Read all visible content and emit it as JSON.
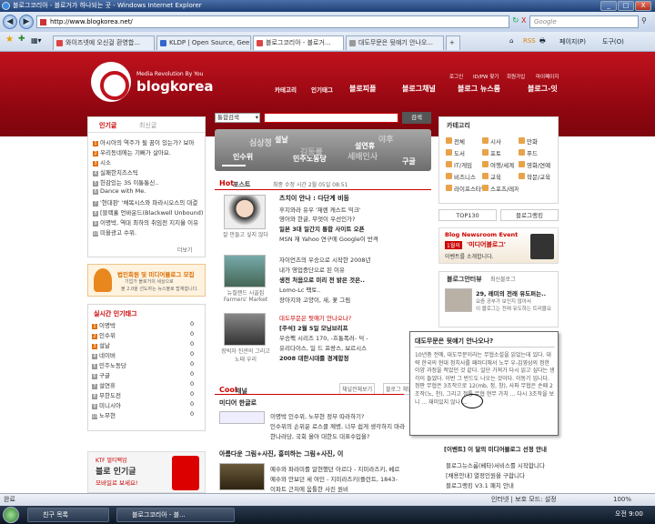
{
  "window": {
    "title": "블로그코리아 - 블로거가 하나되는 곳 - Windows Internet Explorer",
    "min": "_",
    "max": "□",
    "close": "X"
  },
  "address": {
    "url": "http://www.blogkorea.net/",
    "search_placeholder": "Google",
    "back": "◀",
    "forward": "▶",
    "refresh": "↻",
    "stop": "X"
  },
  "tabs": [
    "와이즈넷에 오신걸 환영합...",
    "KLDP | Open Source, Gee...",
    "블로그코리아 - 블로거...",
    "대도무문은 뒷얘기 안나오..."
  ],
  "toolbar": {
    "home": "⌂",
    "feeds": "RSS",
    "print": "🖶",
    "page": "페이지(P)",
    "tools": "도구(O)"
  },
  "site": {
    "logo": "blogkorea",
    "tagline": "Media Revolution By You",
    "toplinks": [
      "로그인",
      "ID/PW 찾기",
      "회원가입",
      "마이페이지"
    ],
    "nav": [
      "카테고리",
      "인기태그",
      "블로피플",
      "블로그채널",
      "블로그 뉴스룸",
      "블로그-잇"
    ],
    "search": {
      "scope": "통합검색",
      "button": "검색"
    },
    "popular": {
      "tab1": "인기글",
      "tab2": "최신글",
      "more": "더보기",
      "items": [
        "아시아의 역주가 될 꿈이 있는가? 보아",
        "우리동네에는 기뻐가 살아요.",
        "시소",
        "실패한치즈스틱",
        "헌감있는 3S 이통통신..",
        "Dance with Me.",
        "'현대판' '채목시스와 파라시오스의 대결",
        "[블랙홀 언바운드(Blackwell Unbound)]",
        "이명박, 역대 최하의 취임전 지지율 이유",
        "미을광고 수위."
      ]
    },
    "tagcloud": {
      "words": [
        "심상정",
        "설날",
        "야후",
        "김동률",
        "설연휴",
        "인수위",
        "민주노동당",
        "세배인사",
        "구글"
      ]
    },
    "hotpost": {
      "label": "Hot",
      "label2": "포스트",
      "updated": "최종 수정 시간 2월 05일 08:51",
      "main_title": "츠치이 안나 : 다단계 비등",
      "main_lines": [
        "후지와라 유우 '재렌 캐스트 믹크'",
        "영어와 한글, 무엇이 우선인가?"
      ],
      "main_bold1": "일본 3대 일간지 통합 사이트 오픈",
      "main_line2": "MSN 재 Yahoo 연구에 Google이 반격",
      "thumb1_caption": "잘 만들고 싶지 않다",
      "second_lines": [
        "자이언츠의 우승으로 시작한 2008년",
        "내가 영업중단으로 된 이유",
        "연말상을 받은 남자에게 무서운 거"
      ],
      "second_bold": "생전 처음으로 미리 전 밝은 것은..",
      "second_lines2": [
        "Lomo-Lc 팩토..",
        "장아지와 고양이, 새, 꽃 그림"
      ],
      "thumb2_caption": "뉴질랜드 시골집 Farmers' Market",
      "third_lines": [
        "대도무문은 뒷얘기 안나오나?",
        "[주석] 2월 5일 모닝브리프",
        "우승팩 시리즈 170, -흐통폭러- 덕 -"
      ],
      "third_bold": "2008 대한시대를 경계합정",
      "third_lines2": [
        "유리다이스, 일 드 프랑스, 보르시스"
      ],
      "thumb3_caption": "장빅자 진관의 그리고 노태 우리"
    },
    "cool": {
      "label": "Cool",
      "label2": "채널",
      "more1": "채널전체보기",
      "more2": "블로그 채널",
      "sub": "미디어 한글로",
      "lines": [
        "이명박 인수위, 노무현 정부 따라하기?",
        "인수위의 손위운 로스클 께병, 너무 쉽게 생각하지 마라",
        "한나라당, 국회 올아 대한도 대표수입을?"
      ],
      "sub2": "아름다운 그림+사진, 흥미하는 그림+사진, 이",
      "lines2": [
        "예수와 파라미를 알현했던 아르다 - 지미라즈키, 베르",
        "예수와 안보던 세 여인 - 지미라즈키(플런트, 1843-",
        "이파트 근처에 움툴한 사진 원비"
      ]
    },
    "tags": {
      "title": "실시간 인기태그",
      "items": [
        {
          "name": "이명박",
          "n": "0"
        },
        {
          "name": "인수위",
          "n": "0"
        },
        {
          "name": "설날",
          "n": "0"
        },
        {
          "name": "네이버",
          "n": "0"
        },
        {
          "name": "민주노동당",
          "n": "0"
        },
        {
          "name": "구글",
          "n": "0"
        },
        {
          "name": "설연휴",
          "n": "0"
        },
        {
          "name": "무한도전",
          "n": "0"
        },
        {
          "name": "미니시아",
          "n": "0"
        },
        {
          "name": "노무현",
          "n": "0"
        }
      ]
    },
    "promo": {
      "title": "법인회원 및 미디어블로그 모집",
      "sub": "기업가 블로거의 세상으로",
      "sub2": "블 2.0을 선도하는 뉴스블로 탑재합니다."
    },
    "ktf": {
      "line1": "KTF 멀티팩업",
      "line2": "블로 인기글",
      "line3": "모바일로 보세요!"
    },
    "category": {
      "title": "카테고리",
      "items": [
        "전체",
        "시사",
        "만화",
        "도서",
        "포토",
        "푸드",
        "IT/게임",
        "여행/세계",
        "영화/연예",
        "비즈니스",
        "교육",
        "학문/교육",
        "라이프스타일",
        "스포츠/레저"
      ]
    },
    "top130": "TOP130",
    "blogrank": "블로그랭킹",
    "event": {
      "line1": "Blog Newsroom Event",
      "line2": "1월의",
      "line3": "'미디어블로그'",
      "line4": "이벤트를 소개합니다."
    },
    "blogger": {
      "tab1": "블로그안터뷰",
      "tab2": "최신블로그",
      "title": "29, 레미의 전래 유도퍼는..",
      "lines": [
        "요즘 공부가 보인지 않아서",
        "이 블로그는 전래 유도하는 트러블요"
      ]
    },
    "popup": {
      "title": "대도무문은 뒷얘기 안나오나?",
      "text": "10년층 전에, 대도무문이라는 무협소설을 읽었는데 있다. 대략 한국의 현대 정치사를 패러디해서 노무 우-김영삼의 정한 이양 과정을 적었던 것 같다. 일단 가져가 다시 읽고 싶다는 생각이 들었다. 이번 그 반드도 나오는 것이다. 이동기 입니다. 정판 무협은 3조작으로 12(mb, 정, 창), 사파 무협은 손패 2조작(노, 천), 그리고 정통 무협 현무 가치 ... 다시 3조작을 보니 ... 재미있지 않나 ..."
    },
    "events2": {
      "title": "[이벤트] 이 달의 미디어블로그 선정 안내",
      "lines": [
        "블로그뉴스룸(베타)서비스를 시작합니다",
        "[채용안내] 열정인원을 구합니다",
        "블로그랭킹 V3.1 패치 안내"
      ]
    }
  },
  "status": {
    "left": "완료",
    "zone": "인터넷 | 보호 모드: 설정",
    "zoom": "100%"
  },
  "taskbar": {
    "items": [
      "친구 목록",
      "블로그코리아 - 블..."
    ],
    "clock": "오전 9:00"
  }
}
